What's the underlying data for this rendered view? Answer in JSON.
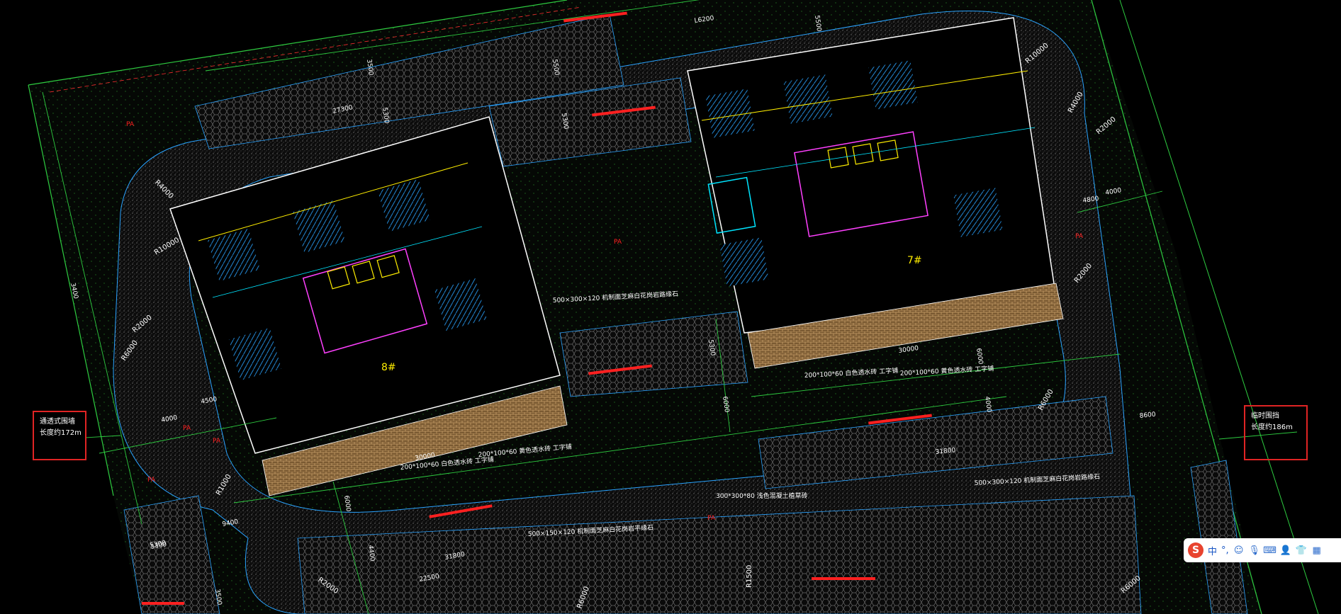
{
  "drawing": {
    "building_labels": [
      "8#",
      "7#"
    ],
    "area_labels": [
      "PA",
      "PA",
      "PA",
      "PA",
      "PA",
      "PA",
      "PA"
    ],
    "dimensions": [
      "L6200",
      "5500",
      "3500",
      "5500",
      "27300",
      "5300",
      "5300",
      "5300",
      "30000",
      "30000",
      "31800",
      "31800",
      "22500",
      "4500",
      "4000",
      "6000",
      "6000",
      "6000",
      "4000",
      "4400",
      "5300",
      "8600",
      "4000",
      "9400",
      "5300",
      "3500",
      "4800",
      "3400"
    ],
    "radii": [
      "R4000",
      "R10000",
      "R2000",
      "R6000",
      "R1000",
      "R4000",
      "R10000",
      "R2000",
      "R2000",
      "R6000",
      "R2000",
      "R6000",
      "R6000",
      "R1500"
    ],
    "annotations": [
      "500×300×120 机制面芝麻白花岗岩路缘石",
      "200*100*60 白色透水砖  工字铺",
      "200*100*60 黄色透水砖  工字铺",
      "200*100*60 白色透水砖  工字铺",
      "200*100*60 黄色透水砖  工字铺",
      "500×300×120 机制面芝麻白花岗岩路缘石",
      "300*300*80 浅色混凝土植草砖",
      "500×150×120 机制面芝麻白花岗岩平缘石"
    ]
  },
  "callouts": {
    "left": {
      "line1": "通透式围墙",
      "line2": "长度约172m"
    },
    "right": {
      "line1": "临时围挡",
      "line2": "长度约186m"
    }
  },
  "ime_toolbar": {
    "logo": "S",
    "mode": "中",
    "punct": "°,",
    "icons": [
      "emoji-icon",
      "microphone-icon",
      "keyboard-icon",
      "user-icon",
      "skin-icon",
      "grid-icon"
    ]
  },
  "colors": {
    "background": "#000000",
    "green_line": "#2ecc40",
    "red_text": "#ff2020",
    "yellow": "#ffee00",
    "magenta": "#ff40ff",
    "cyan": "#00e5ff",
    "blue_hatch": "#2aa3ff",
    "paving": "#b08755"
  }
}
